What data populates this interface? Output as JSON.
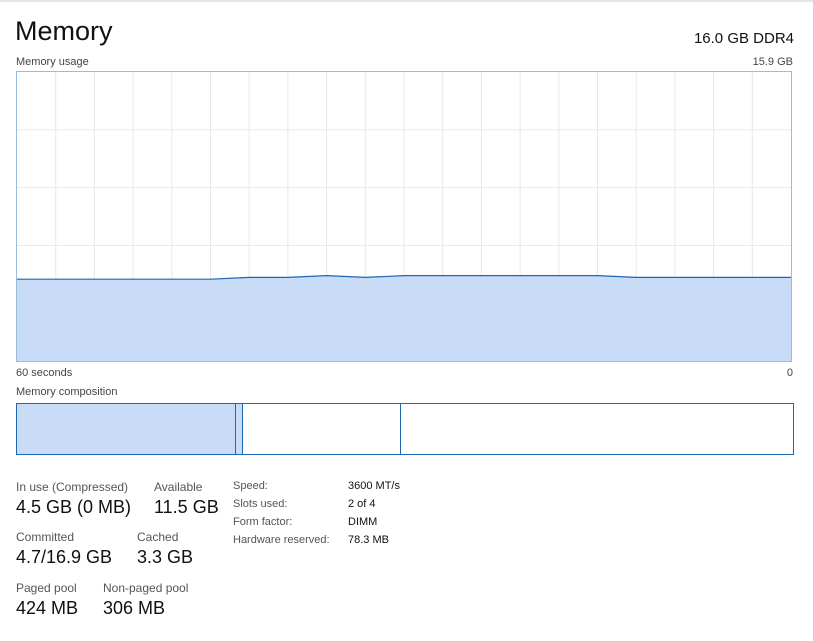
{
  "title": "Memory",
  "spec": "16.0 GB DDR4",
  "chart": {
    "label": "Memory usage",
    "max_label": "15.9 GB",
    "time_left": "60 seconds",
    "time_right": "0"
  },
  "composition": {
    "label": "Memory composition"
  },
  "stats": {
    "in_use": {
      "label": "In use (Compressed)",
      "value": "4.5 GB (0 MB)"
    },
    "available": {
      "label": "Available",
      "value": "11.5 GB"
    },
    "committed": {
      "label": "Committed",
      "value": "4.7/16.9 GB"
    },
    "cached": {
      "label": "Cached",
      "value": "3.3 GB"
    },
    "paged_pool": {
      "label": "Paged pool",
      "value": "424 MB"
    },
    "nonpaged_pool": {
      "label": "Non-paged pool",
      "value": "306 MB"
    }
  },
  "info": {
    "speed": {
      "label": "Speed:",
      "value": "3600 MT/s"
    },
    "slots": {
      "label": "Slots used:",
      "value": "2 of 4"
    },
    "form": {
      "label": "Form factor:",
      "value": "DIMM"
    },
    "reserved": {
      "label": "Hardware reserved:",
      "value": "78.3 MB"
    }
  },
  "colors": {
    "fill": "#c8dcf8",
    "line": "#1f66b3",
    "grid": "#e8e8e8"
  },
  "chart_data": {
    "type": "area",
    "title": "Memory usage",
    "xlabel": "",
    "ylabel": "",
    "x_range": [
      "60 seconds",
      "0"
    ],
    "ylim": [
      0,
      15.9
    ],
    "x": [
      60,
      57,
      54,
      51,
      48,
      45,
      42,
      39,
      36,
      33,
      30,
      27,
      24,
      21,
      18,
      15,
      12,
      9,
      6,
      3,
      0
    ],
    "values": [
      4.5,
      4.5,
      4.5,
      4.5,
      4.5,
      4.5,
      4.6,
      4.6,
      4.7,
      4.6,
      4.7,
      4.7,
      4.7,
      4.7,
      4.7,
      4.7,
      4.6,
      4.6,
      4.6,
      4.6,
      4.6
    ],
    "grid": true
  }
}
